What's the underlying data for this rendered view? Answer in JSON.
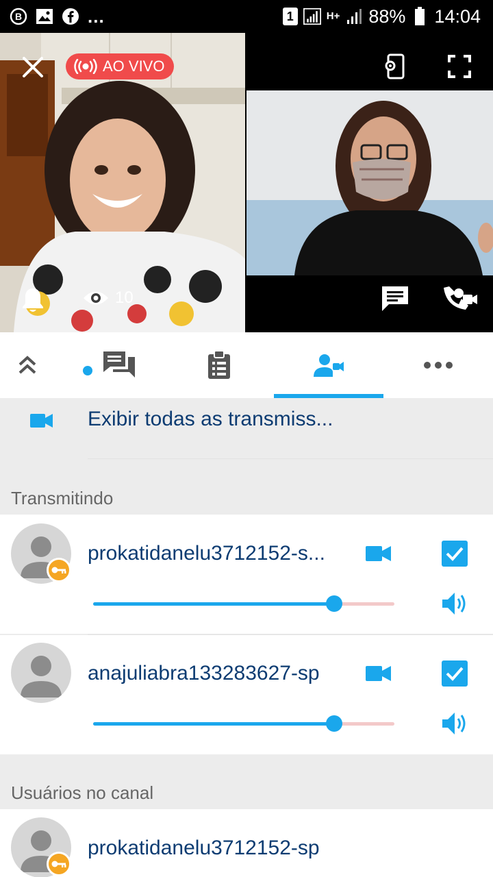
{
  "status_bar": {
    "notification_icons": [
      "b-circle-icon",
      "image-icon",
      "facebook-icon"
    ],
    "overflow": "...",
    "sim": "1",
    "network": "H+",
    "battery": "88%",
    "time": "14:04"
  },
  "stream": {
    "live_label": "AO VIVO",
    "viewer_count": "10"
  },
  "tabs": [
    {
      "name": "collapse",
      "icon": "double-chevron-up-icon",
      "active": false
    },
    {
      "name": "chat",
      "icon": "chat-icon",
      "active": false,
      "has_dot": true
    },
    {
      "name": "clipboard",
      "icon": "clipboard-icon",
      "active": false
    },
    {
      "name": "broadcasts",
      "icon": "user-video-icon",
      "active": true
    },
    {
      "name": "more",
      "icon": "more-icon",
      "active": false
    }
  ],
  "list": {
    "show_all_label": "Exibir todas as transmiss...",
    "section_broadcasting": "Transmitindo",
    "broadcasters": [
      {
        "username": "prokatidanelu3712152-s...",
        "is_owner": true,
        "checked": true,
        "volume": 0.8
      },
      {
        "username": "anajuliabra133283627-sp",
        "is_owner": false,
        "checked": true,
        "volume": 0.8
      }
    ],
    "section_users": "Usuários no canal",
    "channel_users": [
      {
        "username": "prokatidanelu3712152-sp",
        "is_owner": true
      }
    ]
  },
  "colors": {
    "accent": "#1aa7ec",
    "live_red": "#f04b4b",
    "key_badge": "#f5a623",
    "text_dark_blue": "#0d3c72"
  }
}
